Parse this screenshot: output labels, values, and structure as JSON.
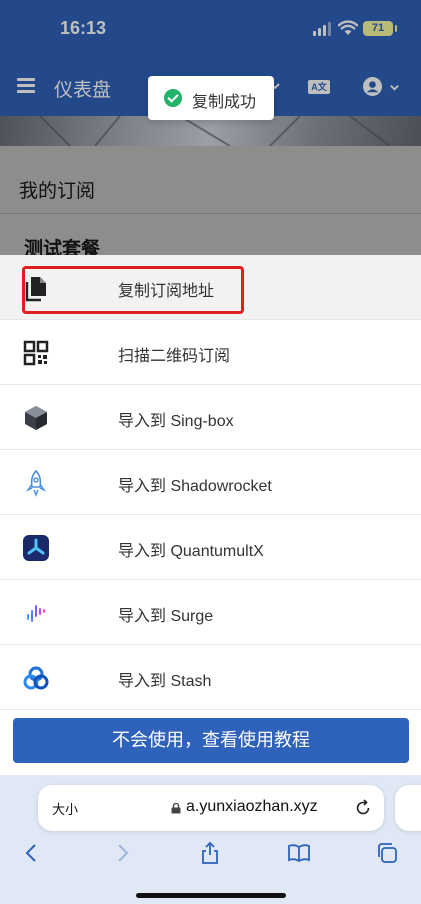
{
  "status_bar": {
    "time": "16:13",
    "battery": "71"
  },
  "header": {
    "title": "仪表盘",
    "lang_icon_text": "A文"
  },
  "toast": {
    "message": "复制成功"
  },
  "page": {
    "section_title": "我的订阅",
    "plan_name": "测试套餐"
  },
  "sheet": {
    "items": [
      {
        "label": "复制订阅地址",
        "icon": "copy-icon"
      },
      {
        "label": "扫描二维码订阅",
        "icon": "qrcode-icon"
      },
      {
        "label": "导入到 Sing-box",
        "icon": "sing-box-icon"
      },
      {
        "label": "导入到 Shadowrocket",
        "icon": "shadowrocket-icon"
      },
      {
        "label": "导入到 QuantumultX",
        "icon": "quantumultx-icon"
      },
      {
        "label": "导入到 Surge",
        "icon": "surge-icon"
      },
      {
        "label": "导入到 Stash",
        "icon": "stash-icon"
      }
    ],
    "tutorial_button": "不会使用，查看使用教程"
  },
  "browser": {
    "text_size": "大小",
    "url": "a.yunxiaozhan.xyz"
  },
  "colors": {
    "primary": "#2f62ba",
    "success": "#21b36a",
    "highlight": "#e02020"
  }
}
